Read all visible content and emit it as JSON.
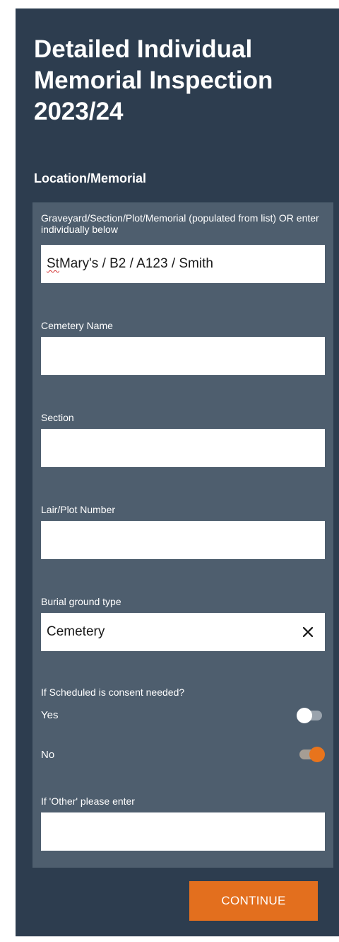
{
  "header": {
    "title": "Detailed Individual Memorial Inspection 2023/24"
  },
  "section": {
    "title": "Location/Memorial"
  },
  "fields": {
    "memorial_lookup": {
      "label": "Graveyard/Section/Plot/Memorial (populated from list) OR enter individually below",
      "value_first_word": "St",
      "value_rest": " Mary's / B2 / A123 / Smith"
    },
    "cemetery_name": {
      "label": "Cemetery Name",
      "value": ""
    },
    "section": {
      "label": "Section",
      "value": ""
    },
    "lair_plot_number": {
      "label": "Lair/Plot Number",
      "value": ""
    },
    "burial_ground_type": {
      "label": "Burial ground type",
      "value": "Cemetery",
      "clear_icon": "close-icon"
    },
    "consent_question": {
      "label": "If Scheduled is consent needed?",
      "options": [
        {
          "label": "Yes",
          "checked": false
        },
        {
          "label": "No",
          "checked": true
        }
      ]
    },
    "other_enter": {
      "label": "If 'Other' please enter",
      "value": ""
    }
  },
  "actions": {
    "continue_label": "CONTINUE"
  },
  "colors": {
    "background": "#2d3d4f",
    "panel": "#4e5e6e",
    "accent": "#e36f1e",
    "input": "#ffffff"
  }
}
